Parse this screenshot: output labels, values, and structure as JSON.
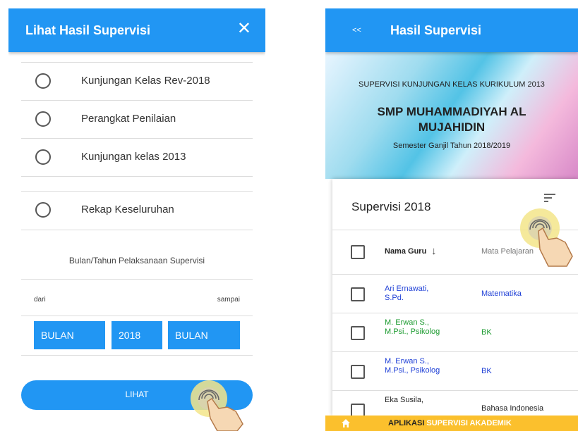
{
  "left": {
    "title": "Lihat Hasil Supervisi",
    "close_glyph": "✕",
    "options": [
      {
        "label": "Kunjungan Kelas Rev-2018",
        "selected": false
      },
      {
        "label": "Perangkat Penilaian",
        "selected": false
      },
      {
        "label": "Kunjungan kelas 2013",
        "selected": false
      },
      {
        "label": "Rekap Keseluruhan",
        "selected": false
      }
    ],
    "period_label": "Bulan/Tahun Pelaksanaan Supervisi",
    "from_label": "dari",
    "to_label": "sampai",
    "month_from": "BULAN",
    "year": "2018",
    "month_to": "BULAN",
    "submit_label": "LIHAT"
  },
  "right": {
    "back_label": "<<",
    "title": "Hasil Supervisi",
    "banner": {
      "line1": "SUPERVISI KUNJUNGAN KELAS KURIKULUM 2013",
      "school": "SMP MUHAMMADIYAH AL MUJAHIDIN",
      "semester": "Semester Ganjil Tahun 2018/2019"
    },
    "card_title": "Supervisi 2018",
    "columns": {
      "name": "Nama Guru",
      "name_sort": "↓",
      "subject": "Mata Pelajaran"
    },
    "rows": [
      {
        "name": "Ari Ernawati, S.Pd.",
        "subject": "Matematika",
        "color": "#1e3fd6"
      },
      {
        "name": "M. Erwan S., M.Psi., Psikolog",
        "subject": "BK",
        "color": "#1a9a2e"
      },
      {
        "name": "M. Erwan S., M.Psi., Psikolog",
        "subject": "BK",
        "color": "#1e3fd6"
      },
      {
        "name": "Eka Susila,",
        "subject": "Bahasa Indonesia",
        "color": "#222222"
      }
    ],
    "footer": {
      "word1": "APLIKASI",
      "word2": "SUPERVISI AKADEMIK"
    }
  },
  "colors": {
    "primary": "#2196f3",
    "footer": "#fbc02d",
    "footer_highlight": "#ffffff"
  },
  "icons": {
    "close": "close-icon",
    "radio": "radio-unchecked-icon",
    "sort": "sort-icon",
    "home": "home-icon",
    "tap_hand": "tap-hand-icon"
  }
}
